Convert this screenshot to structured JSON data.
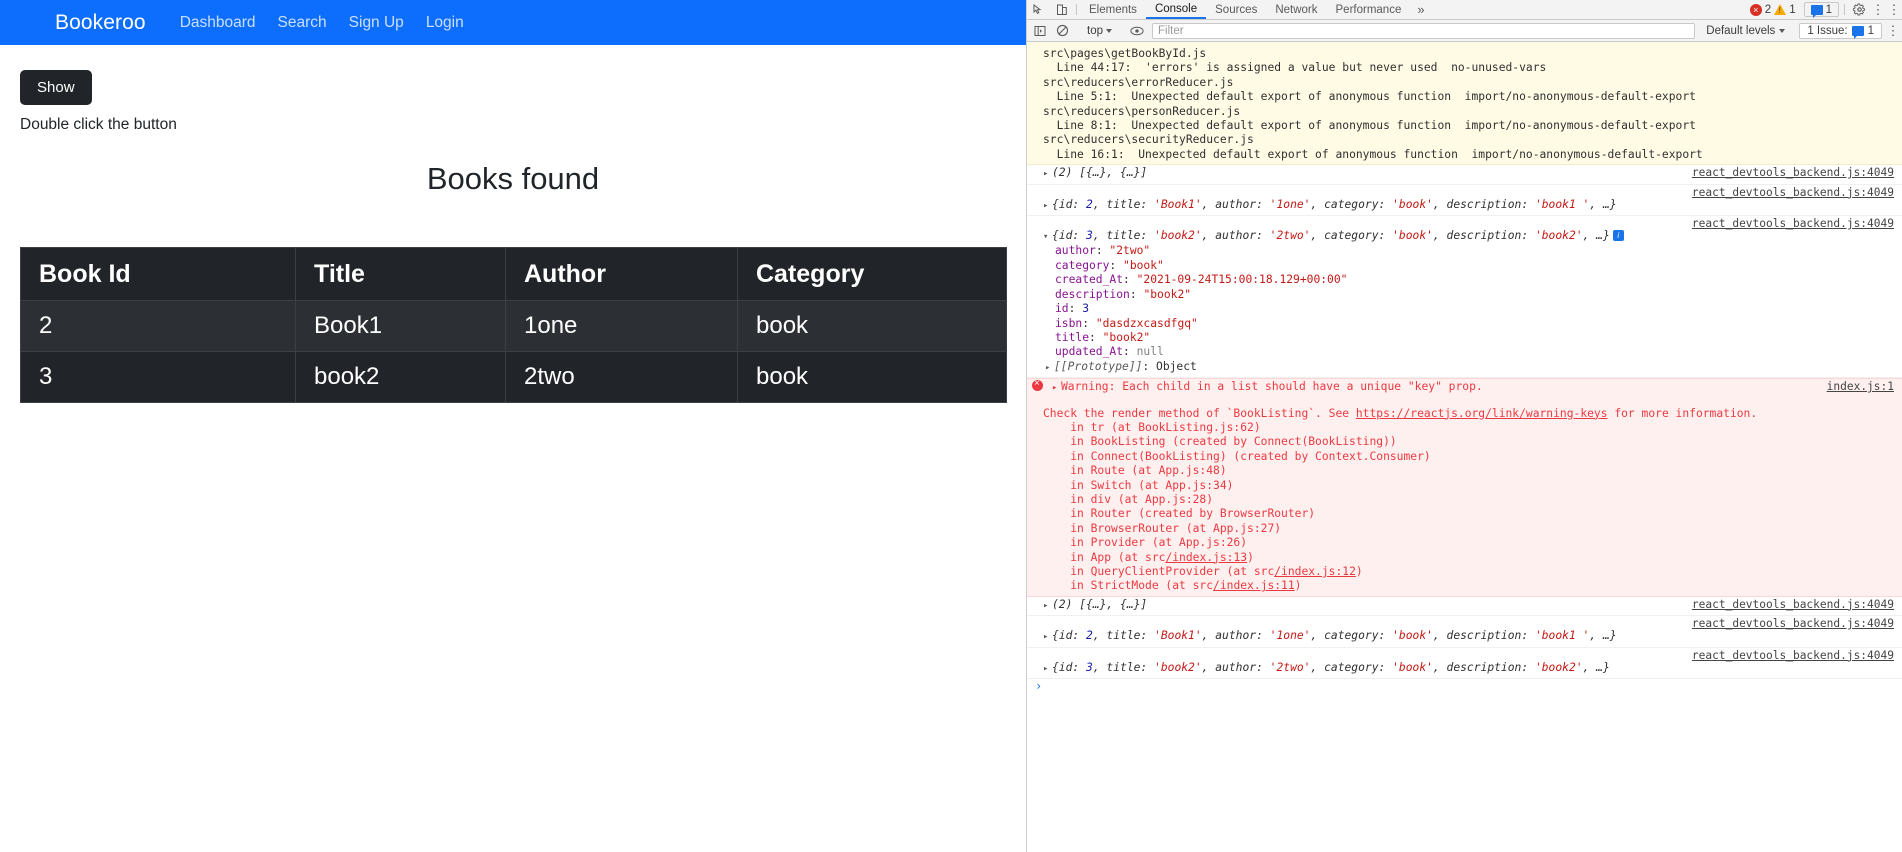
{
  "webpage": {
    "navbar": {
      "brand": "Bookeroo",
      "links": [
        "Dashboard",
        "Search",
        "Sign Up",
        "Login"
      ],
      "background_color": "#0d6efd"
    },
    "show_button_label": "Show",
    "hint_text": "Double click the button",
    "heading": "Books found",
    "table": {
      "headers": [
        "Book Id",
        "Title",
        "Author",
        "Category"
      ],
      "rows": [
        [
          "2",
          "Book1",
          "1one",
          "book"
        ],
        [
          "3",
          "book2",
          "2two",
          "book"
        ]
      ]
    }
  },
  "devtools": {
    "tabs": [
      {
        "label": "Elements",
        "active": false
      },
      {
        "label": "Console",
        "active": true
      },
      {
        "label": "Sources",
        "active": false
      },
      {
        "label": "Network",
        "active": false
      },
      {
        "label": "Performance",
        "active": false
      }
    ],
    "more_tabs_glyph": "»",
    "inspect_icon": "inspect-element-icon",
    "device_icon": "device-toolbar-icon",
    "error_count": "2",
    "warning_count": "1",
    "message_count": "1",
    "settings_icon": "gear-icon",
    "kebab_icon": "more-options-icon",
    "filterbar": {
      "sidebar_toggle_icon": "console-sidebar-icon",
      "clear_icon": "clear-console-icon",
      "context_value": "top",
      "eye_icon": "live-expression-icon",
      "filter_placeholder": "Filter",
      "filter_value": "",
      "levels_label": "Default levels",
      "issues_label": "1 Issue:",
      "issues_count": "1"
    },
    "console": {
      "lint_block": [
        "src\\pages\\getBookById.js",
        "  Line 44:17:  'errors' is assigned a value but never used  no-unused-vars",
        "",
        "src\\reducers\\errorReducer.js",
        "  Line 5:1:  Unexpected default export of anonymous function  import/no-anonymous-default-export",
        "",
        "src\\reducers\\personReducer.js",
        "  Line 8:1:  Unexpected default export of anonymous function  import/no-anonymous-default-export",
        "",
        "src\\reducers\\securityReducer.js",
        "  Line 16:1:  Unexpected default export of anonymous function  import/no-anonymous-default-export"
      ],
      "source_link": "react_devtools_backend.js:4049",
      "array_preview": "(2) [{…}, {…}]",
      "obj_book1_preview_parts": {
        "pre": "{id: ",
        "id": "2",
        "mid1": ", title: ",
        "title": "'Book1'",
        "mid2": ", author: ",
        "author": "'1one'",
        "mid3": ", category: ",
        "category": "'book'",
        "mid4": ", description: ",
        "description": "'book1 '",
        "post": ", …}"
      },
      "obj_book2_preview_parts": {
        "pre": "{id: ",
        "id": "3",
        "mid1": ", title: ",
        "title": "'book2'",
        "mid2": ", author: ",
        "author": "'2two'",
        "mid3": ", category: ",
        "category": "'book'",
        "mid4": ", description: ",
        "description": "'book2'",
        "post": ", …}"
      },
      "expanded_object": [
        {
          "key": "author",
          "value": "\"2two\"",
          "type": "string"
        },
        {
          "key": "category",
          "value": "\"book\"",
          "type": "string"
        },
        {
          "key": "created_At",
          "value": "\"2021-09-24T15:00:18.129+00:00\"",
          "type": "string"
        },
        {
          "key": "description",
          "value": "\"book2\"",
          "type": "string"
        },
        {
          "key": "id",
          "value": "3",
          "type": "number"
        },
        {
          "key": "isbn",
          "value": "\"dasdzxcasdfgq\"",
          "type": "string"
        },
        {
          "key": "title",
          "value": "\"book2\"",
          "type": "string"
        },
        {
          "key": "updated_At",
          "value": "null",
          "type": "null"
        }
      ],
      "prototype_row": {
        "label": "[[Prototype]]",
        "value": ": Object"
      },
      "error": {
        "source_link": "index.js:1",
        "line1": "Warning: Each child in a list should have a unique \"key\" prop.",
        "line2_pre": "Check the render method of `BookListing`. See ",
        "line2_link": "https://reactjs.org/link/warning-keys",
        "line2_post": " for more information.",
        "stack": [
          "    in tr (at BookListing.js:62)",
          "    in BookListing (created by Connect(BookListing))",
          "    in Connect(BookListing) (created by Context.Consumer)",
          "    in Route (at App.js:48)",
          "    in Switch (at App.js:34)",
          "    in div (at App.js:28)",
          "    in Router (created by BrowserRouter)",
          "    in BrowserRouter (at App.js:27)",
          "    in Provider (at App.js:26)"
        ],
        "stack_linked": [
          {
            "pre": "    in App (at src",
            "link": "/index.js:13",
            "post": ")"
          },
          {
            "pre": "    in QueryClientProvider (at src",
            "link": "/index.js:12",
            "post": ")"
          },
          {
            "pre": "    in StrictMode (at src",
            "link": "/index.js:11",
            "post": ")"
          }
        ]
      },
      "prompt_glyph": "›"
    }
  }
}
